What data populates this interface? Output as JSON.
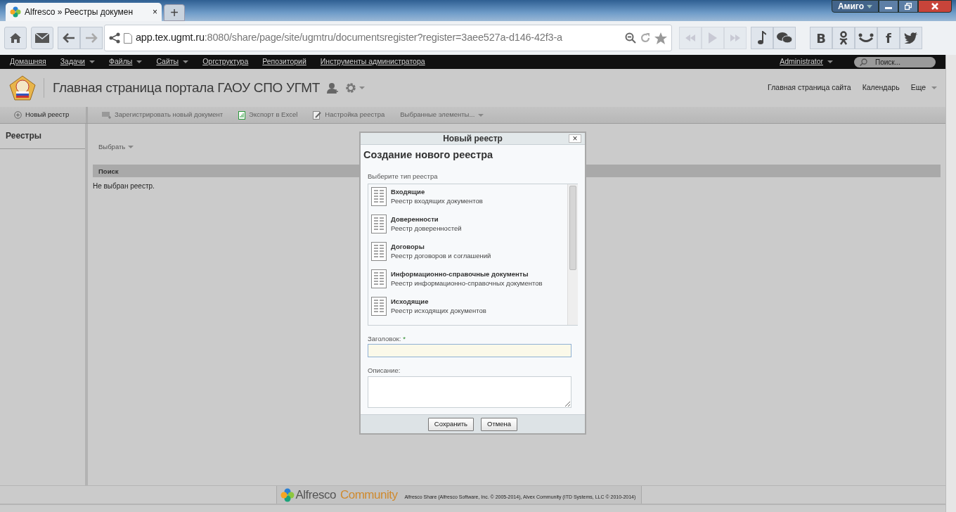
{
  "browser": {
    "tab_title": "Alfresco » Реестры докумен",
    "tab_close": "×",
    "new_tab": "+",
    "profile_button": "Амиго",
    "url_host": "app.tex.ugmt.ru",
    "url_rest": ":8080/share/page/site/ugmtru/documentsregister?register=3aee527a-d146-42f3-a",
    "social_buttons": [
      {
        "kind": "text",
        "label": "B"
      },
      {
        "kind": "ok"
      },
      {
        "kind": "smile"
      },
      {
        "kind": "text",
        "label": "f"
      },
      {
        "kind": "bird"
      }
    ]
  },
  "app_nav": {
    "items": [
      {
        "label": "Домашняя",
        "dropdown": false
      },
      {
        "label": "Задачи",
        "dropdown": true
      },
      {
        "label": "Файлы",
        "dropdown": true
      },
      {
        "label": "Сайты",
        "dropdown": true
      },
      {
        "label": "Оргструктура",
        "dropdown": false
      },
      {
        "label": "Репозиторий",
        "dropdown": false
      },
      {
        "label": "Инструменты администратора",
        "dropdown": false
      }
    ],
    "user": "Administrator",
    "search": {
      "placeholder": "Поиск..."
    }
  },
  "site": {
    "title": "Главная страница портала ГАОУ СПО УГМТ",
    "links": [
      {
        "label": "Главная страница сайта",
        "dropdown": false
      },
      {
        "label": "Календарь",
        "dropdown": false
      },
      {
        "label": "Еще",
        "dropdown": true
      }
    ]
  },
  "toolbar": {
    "new_register": "Новый реестр",
    "actions": [
      {
        "label": "Зарегистрировать новый документ",
        "disabled": true,
        "dropdown": false
      },
      {
        "label": "Экспорт в Excel",
        "disabled": true,
        "dropdown": false
      },
      {
        "label": "Настройка реестра",
        "disabled": true,
        "dropdown": false
      },
      {
        "label": "Выбранные элементы...",
        "disabled": true,
        "dropdown": true
      }
    ]
  },
  "sidebar": {
    "heading": "Реестры"
  },
  "content": {
    "select": "Выбрать",
    "table_header": "Поиск",
    "empty_message": "Не выбран реестр."
  },
  "dialog": {
    "title": "Новый реестр",
    "close": "×",
    "heading": "Создание нового реестра",
    "list_label": "Выберите тип реестра",
    "types": [
      {
        "name": "Входящие",
        "description": "Реестр входящих документов"
      },
      {
        "name": "Доверенности",
        "description": "Реестр доверенностей"
      },
      {
        "name": "Договоры",
        "description": "Реестр договоров и соглашений"
      },
      {
        "name": "Информационно-справочные документы",
        "description": "Реестр информационно-справочных документов"
      },
      {
        "name": "Исходящие",
        "description": "Реестр исходящих документов"
      }
    ],
    "title_field": {
      "label": "Заголовок:",
      "required_mark": "*"
    },
    "description_field": {
      "label": "Описание:"
    },
    "buttons": [
      "Сохранить",
      "Отмена"
    ]
  },
  "footer": {
    "brand": "Alfresco",
    "edition": "Community",
    "copyright": "Alfresco Share (Alfresco Software, Inc. © 2005-2014), Alvex Community (ITD Systems, LLC © 2010-2014)"
  }
}
